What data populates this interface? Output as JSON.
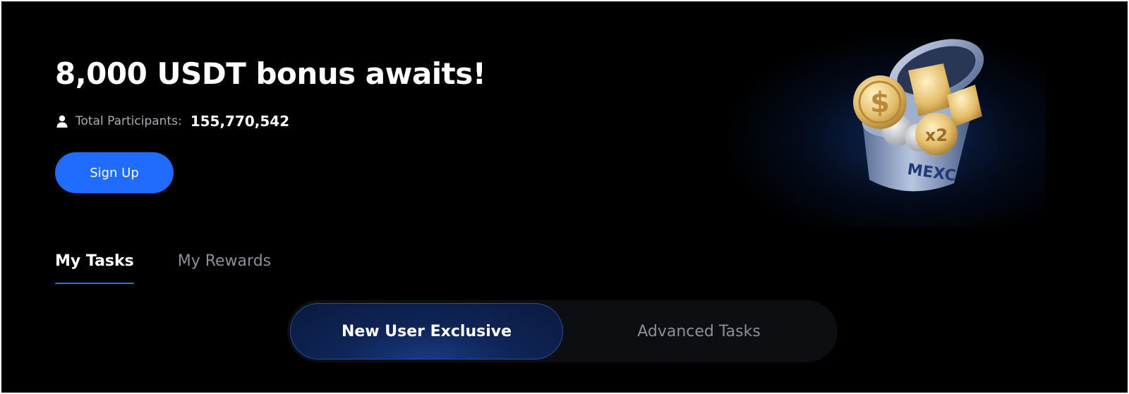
{
  "hero": {
    "headline": "8,000 USDT bonus awaits!",
    "participants_label": "Total Participants:",
    "participants_count": "155,770,542",
    "signup_label": "Sign Up",
    "brand_mark": "MEXC"
  },
  "tabs": [
    {
      "label": "My Tasks",
      "active": true
    },
    {
      "label": "My Rewards",
      "active": false
    }
  ],
  "task_filter": {
    "options": [
      {
        "label": "New User Exclusive",
        "active": true
      },
      {
        "label": "Advanced Tasks",
        "active": false
      }
    ]
  },
  "colors": {
    "background": "#000000",
    "primary": "#1f6cff",
    "muted_text": "#8a8f99"
  },
  "icons": {
    "participants": "user-icon",
    "illustration": "coin-tin-illustration"
  }
}
